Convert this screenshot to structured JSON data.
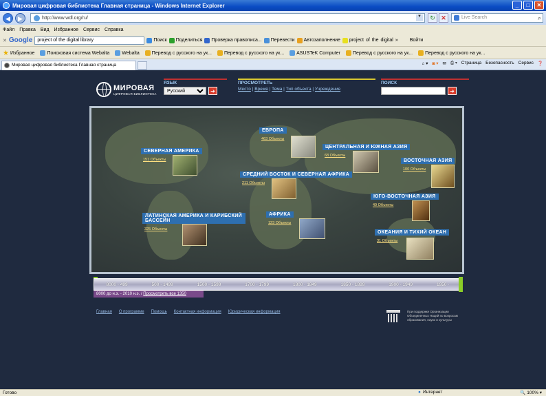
{
  "window": {
    "title": "Мировая цифровая библиотека Главная страница - Windows Internet Explorer"
  },
  "addressbar": {
    "url": "http://www.wdl.org/ru/",
    "search_placeholder": "Live Search"
  },
  "menu": [
    "Файл",
    "Правка",
    "Вид",
    "Избранное",
    "Сервис",
    "Справка"
  ],
  "google": {
    "logo": "Google",
    "query": "project of the digital library",
    "items": [
      "Поиск",
      "Поделиться",
      "Проверка правописа...",
      "Перевести",
      "Автозаполнение",
      "project",
      "of",
      "the",
      "digital",
      "»",
      "Войти"
    ]
  },
  "favorites": {
    "label": "Избранное",
    "items": [
      "Поисковая система Webalta",
      "Webalta",
      "Перевод с русского на ук...",
      "Перевод с русского на ук...",
      "ASUSTeK Computer",
      "Перевод с русского на ук...",
      "Перевод с русского на ук..."
    ]
  },
  "tab": {
    "label": "Мировая цифровая библиотека Главная страница"
  },
  "cmdbar": [
    "Страница",
    "Безопасность",
    "Сервис"
  ],
  "site": {
    "logo_big": "МИРОВАЯ",
    "logo_small": "ЦИФРОВАЯ БИБЛИОТЕКА",
    "lang_heading": "ЯЗЫК",
    "lang_value": "Русский",
    "browse_heading": "ПРОСМОТРЕТЬ",
    "browse_links": [
      "Место",
      "Время",
      "Тема",
      "Тип объекта",
      "Учреждение"
    ],
    "search_heading": "ПОИСК"
  },
  "regions": [
    {
      "name": "ЕВРОПА",
      "count": "463 Объекты"
    },
    {
      "name": "ЦЕНТРАЛЬНАЯ И ЮЖНАЯ АЗИЯ",
      "count": "68 Объекты"
    },
    {
      "name": "СЕВЕРНАЯ АМЕРИКА",
      "count": "151 Объекты"
    },
    {
      "name": "ВОСТОЧНАЯ АЗИЯ",
      "count": "100 Объекты"
    },
    {
      "name": "СРЕДНИЙ ВОСТОК И СЕВЕРНАЯ АФРИКА",
      "count": "211 Объекты"
    },
    {
      "name": "ЮГО-ВОСТОЧНАЯ АЗИЯ",
      "count": "49 Объекты"
    },
    {
      "name": "ЛАТИНСКАЯ АМЕРИКА И КАРИБСКИЙ БАССЕЙН",
      "count": "325 Объекты"
    },
    {
      "name": "АФРИКА",
      "count": "123 Объекты"
    },
    {
      "name": "ОКЕАНИЯ И ТИХИЙ ОКЕАН",
      "count": "31 Объекты"
    }
  ],
  "timeline": {
    "ranges": [
      "8000 - 499",
      "500 - 1499",
      "1500 - 1599",
      "1700 - 1799",
      "1800 - 1849",
      "1850 - 1899",
      "1900 - 1949",
      "1950 -"
    ],
    "selected": "8000 до н.э. - 2010 н.э. /",
    "view_all": "Просмотреть все 1350"
  },
  "footer": [
    "Главная",
    "О программе",
    "Помощь",
    "Контактная информация",
    "Юридическая информация"
  ],
  "unesco": "При поддержке Организации Объединенных Наций по вопросам образования, науки и культуры",
  "status": {
    "left": "Готово",
    "zone": "Интернет",
    "zoom": "100%"
  }
}
